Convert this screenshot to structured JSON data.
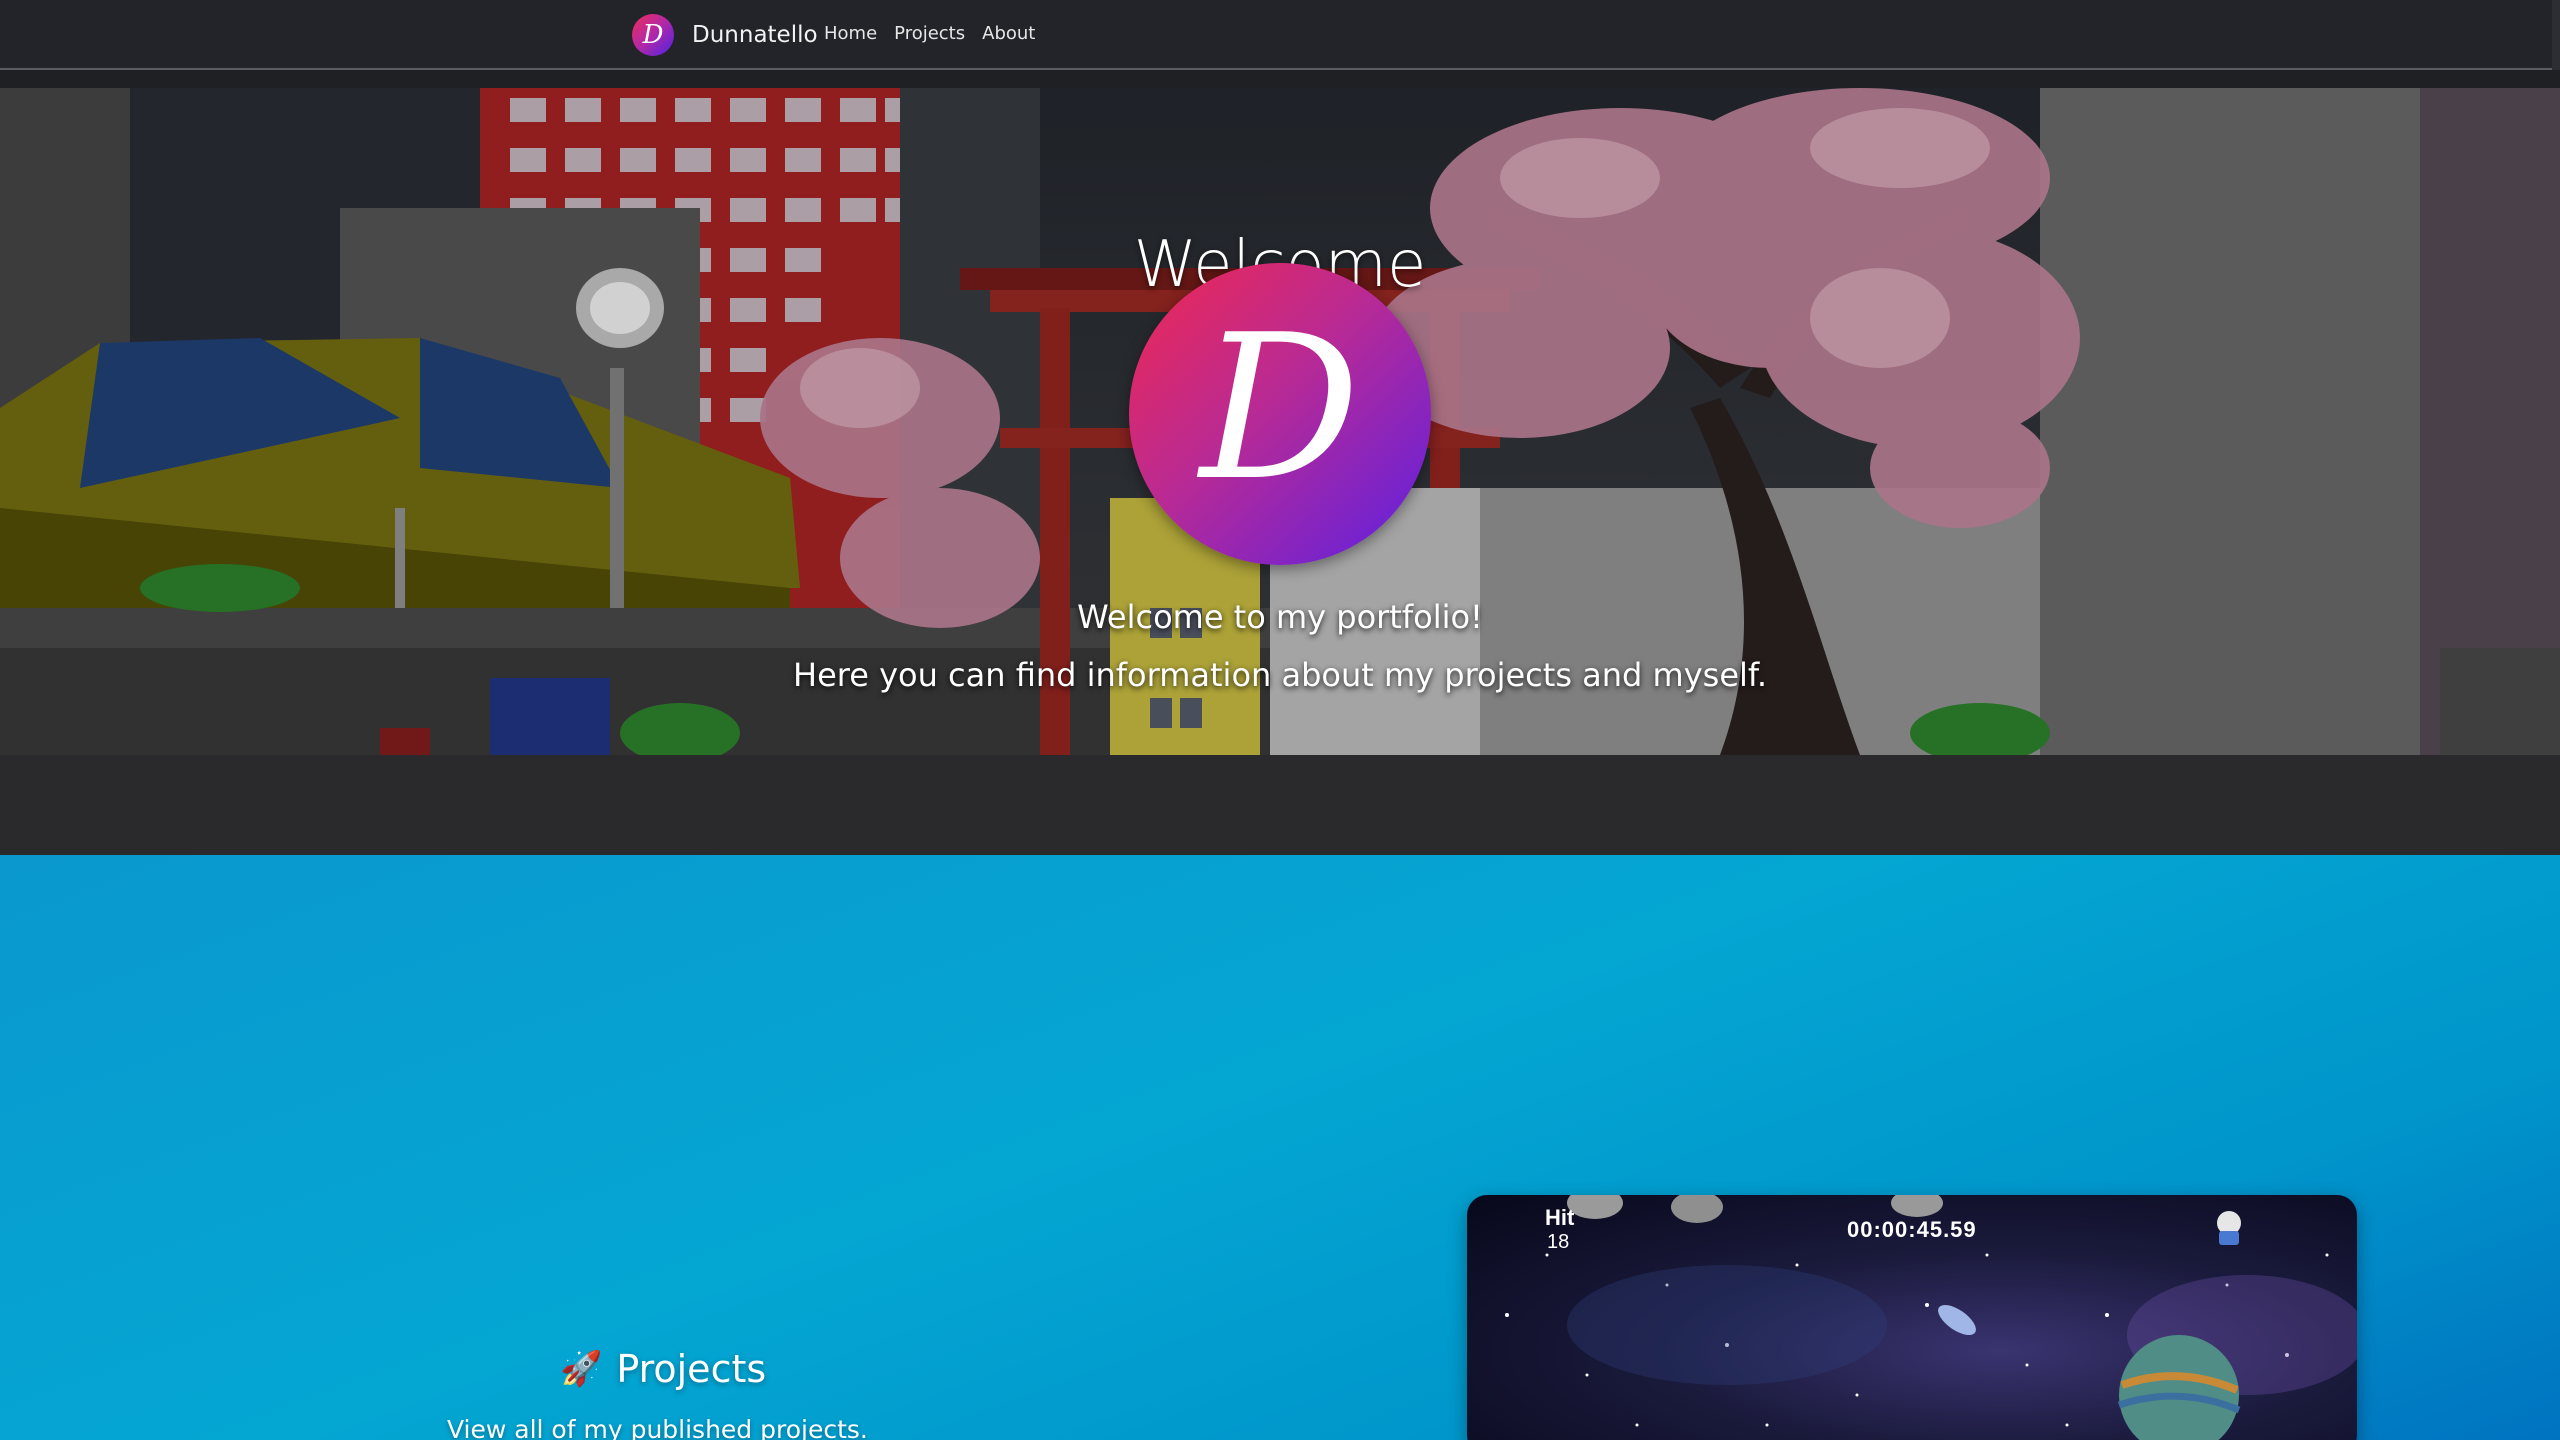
{
  "nav": {
    "brand_initial": "D",
    "brand_name": "Dunnatello",
    "links": [
      "Home",
      "Projects",
      "About"
    ]
  },
  "hero": {
    "title": "Welcome",
    "logo_letter": "D",
    "line1": "Welcome to my portfolio!",
    "line2": "Here you can find information about my projects and myself."
  },
  "projects": {
    "icon": "rocket-icon",
    "rocket_glyph": "🚀",
    "title": "Projects",
    "description": "View all of my published projects."
  },
  "game_preview": {
    "hit_label": "Hit",
    "hit_count": "18",
    "timer": "00:00:45.59"
  },
  "colors": {
    "accent_gradient_start": "#ef2d59",
    "accent_gradient_end": "#4e22e6",
    "navbar_bg": "#222429",
    "projects_bg": "#04a6d2"
  }
}
